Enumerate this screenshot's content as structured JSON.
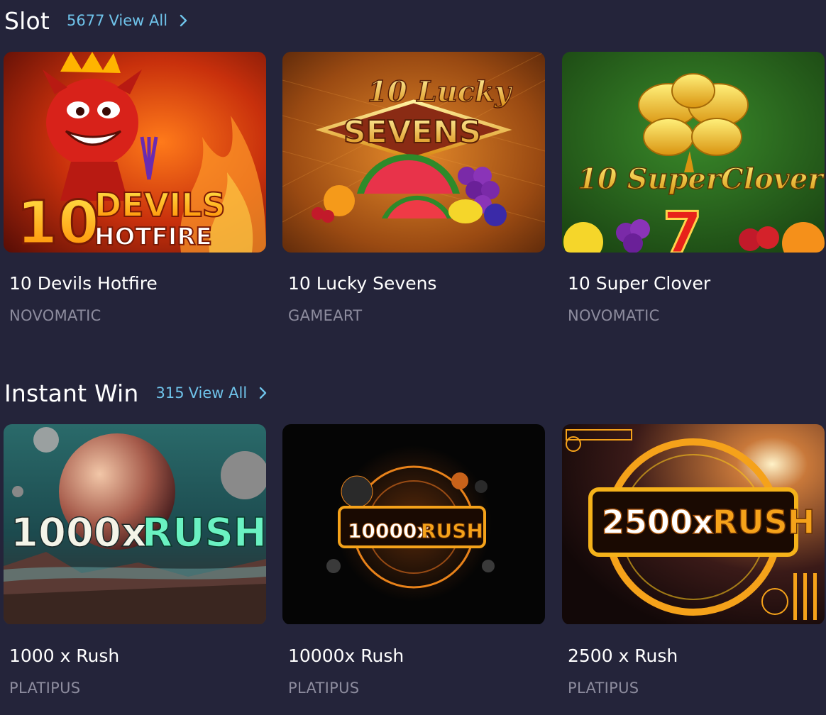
{
  "sections": [
    {
      "title": "Slot",
      "count": "5677",
      "view_all": "View All",
      "games": [
        {
          "name": "10 Devils Hotfire",
          "provider": "NOVOMATIC",
          "art_line1": "10DEVILS",
          "art_line2": "HOTFIRE"
        },
        {
          "name": "10 Lucky Sevens",
          "provider": "GAMEART",
          "art_line1": "10 Lucky",
          "art_line2": "SEVENS"
        },
        {
          "name": "10 Super Clover",
          "provider": "NOVOMATIC",
          "art_line1": "10 SuperClover",
          "art_line2": "7"
        }
      ]
    },
    {
      "title": "Instant Win",
      "count": "315",
      "view_all": "View All",
      "games": [
        {
          "name": "1000 x Rush",
          "provider": "PLATIPUS",
          "art_line1": "1000x",
          "art_line2": "RUSH"
        },
        {
          "name": "10000x Rush",
          "provider": "PLATIPUS",
          "art_line1": "10000x",
          "art_line2": "RUSH"
        },
        {
          "name": "2500 x Rush",
          "provider": "PLATIPUS",
          "art_line1": "2500x",
          "art_line2": "RUSH"
        }
      ]
    }
  ],
  "colors": {
    "background": "#24243a",
    "accent": "#6fc3ea",
    "provider": "#8d8c9e"
  }
}
